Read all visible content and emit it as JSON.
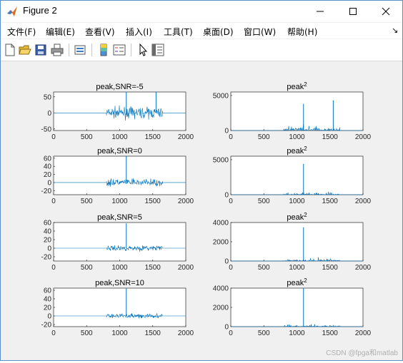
{
  "window": {
    "title": "Figure 2",
    "icon": "matlab-icon",
    "controls": [
      "minimize-icon",
      "maximize-icon",
      "close-icon"
    ]
  },
  "menubar": {
    "items": [
      {
        "label": "文件(F)"
      },
      {
        "label": "编辑(E)"
      },
      {
        "label": "查看(V)"
      },
      {
        "label": "插入(I)"
      },
      {
        "label": "工具(T)"
      },
      {
        "label": "桌面(D)"
      },
      {
        "label": "窗口(W)"
      },
      {
        "label": "帮助(H)"
      }
    ],
    "dock_arrow": "↘"
  },
  "toolbar": {
    "buttons": [
      "new-figure-icon",
      "open-file-icon",
      "save-icon",
      "print-icon",
      "link-plot-icon",
      "colorbar-icon",
      "legend-icon",
      "pointer-icon",
      "property-editor-icon"
    ]
  },
  "watermark": "CSDN @fpga和matlab",
  "colors": {
    "line": "#0072bd",
    "axes_bg": "#ffffff",
    "figure_bg": "#f0f0f0"
  },
  "chart_data": [
    {
      "type": "line",
      "title": "peak,SNR=-5",
      "xlim": [
        0,
        2000
      ],
      "ylim": [
        -55,
        65
      ],
      "x_ticks": [
        "0",
        "500",
        "1000",
        "1500",
        "2000"
      ],
      "y_ticks": [
        "50",
        "0",
        "-50"
      ],
      "y_tick_values": [
        50,
        0,
        -50
      ],
      "noise_start": 800,
      "noise_end": 1650,
      "noise_amp": 28,
      "peak_x": 1100,
      "peak_y": 65,
      "peak2_x": 1550,
      "peak2_y": 65
    },
    {
      "type": "line",
      "title": "peak^2",
      "title_base": "peak",
      "title_sup": "2",
      "xlim": [
        0,
        2000
      ],
      "ylim": [
        0,
        5500
      ],
      "x_ticks": [
        "0",
        "500",
        "1000",
        "1500",
        "2000"
      ],
      "y_ticks": [
        "5000",
        "0"
      ],
      "y_tick_values": [
        5000,
        0
      ],
      "noise_start": 800,
      "noise_end": 1650,
      "noise_amp": 1200,
      "peak_x": 1100,
      "peak_y": 3800,
      "peak2_x": 1550,
      "peak2_y": 4300
    },
    {
      "type": "line",
      "title": "peak,SNR=0",
      "xlim": [
        0,
        2000
      ],
      "ylim": [
        -30,
        65
      ],
      "x_ticks": [
        "0",
        "500",
        "1000",
        "1500",
        "2000"
      ],
      "y_ticks": [
        "60",
        "40",
        "20",
        "0",
        "-20"
      ],
      "y_tick_values": [
        60,
        40,
        20,
        0,
        -20
      ],
      "noise_start": 800,
      "noise_end": 1650,
      "noise_amp": 14,
      "peak_x": 1100,
      "peak_y": 65
    },
    {
      "type": "line",
      "title": "peak^2",
      "title_base": "peak",
      "title_sup": "2",
      "xlim": [
        0,
        2000
      ],
      "ylim": [
        0,
        5500
      ],
      "x_ticks": [
        "0",
        "500",
        "1000",
        "1500",
        "2000"
      ],
      "y_ticks": [
        "5000",
        "0"
      ],
      "y_tick_values": [
        5000,
        0
      ],
      "noise_start": 800,
      "noise_end": 1650,
      "noise_amp": 550,
      "peak_x": 1100,
      "peak_y": 4400
    },
    {
      "type": "line",
      "title": "peak,SNR=5",
      "xlim": [
        0,
        2000
      ],
      "ylim": [
        -30,
        60
      ],
      "x_ticks": [
        "0",
        "500",
        "1000",
        "1500",
        "2000"
      ],
      "y_ticks": [
        "60",
        "40",
        "20",
        "0",
        "-20"
      ],
      "y_tick_values": [
        60,
        40,
        20,
        0,
        -20
      ],
      "noise_start": 800,
      "noise_end": 1650,
      "noise_amp": 10,
      "peak_x": 1100,
      "peak_y": 58
    },
    {
      "type": "line",
      "title": "peak^2",
      "title_base": "peak",
      "title_sup": "2",
      "xlim": [
        0,
        2000
      ],
      "ylim": [
        0,
        4000
      ],
      "x_ticks": [
        "0",
        "500",
        "1000",
        "1500",
        "2000"
      ],
      "y_ticks": [
        "4000",
        "2000",
        "0"
      ],
      "y_tick_values": [
        4000,
        2000,
        0
      ],
      "noise_start": 800,
      "noise_end": 1650,
      "noise_amp": 500,
      "peak_x": 1100,
      "peak_y": 3500
    },
    {
      "type": "line",
      "title": "peak,SNR=10",
      "xlim": [
        0,
        2000
      ],
      "ylim": [
        -25,
        65
      ],
      "x_ticks": [
        "0",
        "500",
        "1000",
        "1500",
        "2000"
      ],
      "y_ticks": [
        "60",
        "40",
        "20",
        "0",
        "-20"
      ],
      "y_tick_values": [
        60,
        40,
        20,
        0,
        -20
      ],
      "noise_start": 800,
      "noise_end": 1650,
      "noise_amp": 9,
      "peak_x": 1100,
      "peak_y": 64
    },
    {
      "type": "line",
      "title": "peak^2",
      "title_base": "peak",
      "title_sup": "2",
      "xlim": [
        0,
        2000
      ],
      "ylim": [
        0,
        4000
      ],
      "x_ticks": [
        "0",
        "500",
        "1000",
        "1500",
        "2000"
      ],
      "y_ticks": [
        "4000",
        "2000",
        "0"
      ],
      "y_tick_values": [
        4000,
        2000,
        0
      ],
      "noise_start": 800,
      "noise_end": 1650,
      "noise_amp": 350,
      "peak_x": 1100,
      "peak_y": 4000
    }
  ]
}
